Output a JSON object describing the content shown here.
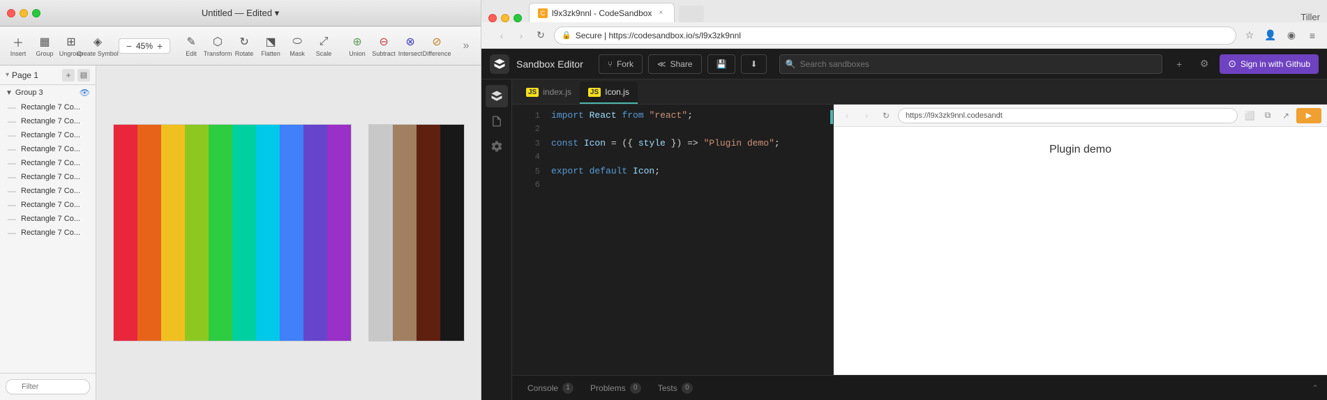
{
  "sketch": {
    "title": "Untitled — Edited ▾",
    "toolbar": {
      "insert_label": "Insert",
      "group_label": "Group",
      "ungroup_label": "Ungroup",
      "create_symbol_label": "Create Symbol",
      "zoom_label": "45%",
      "edit_label": "Edit",
      "transform_label": "Transform",
      "rotate_label": "Rotate",
      "flatten_label": "Flatten",
      "mask_label": "Mask",
      "scale_label": "Scale",
      "union_label": "Union",
      "subtract_label": "Subtract",
      "intersect_label": "Intersect",
      "difference_label": "Difference"
    },
    "sidebar": {
      "page_label": "Page 1",
      "group_name": "Group 3",
      "layers": [
        "Rectangle 7 Co...",
        "Rectangle 7 Co...",
        "Rectangle 7 Co...",
        "Rectangle 7 Co...",
        "Rectangle 7 Co...",
        "Rectangle 7 Co...",
        "Rectangle 7 Co...",
        "Rectangle 7 Co...",
        "Rectangle 7 Co...",
        "Rectangle 7 Co..."
      ],
      "filter_placeholder": "Filter"
    }
  },
  "browser": {
    "tab_title": "l9x3zk9nnl - CodeSandbox",
    "tab_close": "×",
    "url": "https://codesandbox.io/s/l9x3zk9nnl",
    "url_display": "Secure  |  https://codesandbox.io/s/l9x3zk9nnl",
    "tiller_label": "Tiller"
  },
  "codesandbox": {
    "logo_alt": "CodeSandbox",
    "title": "Sandbox Editor",
    "fork_label": "Fork",
    "fork_icon": "⑂",
    "share_label": "Share",
    "search_placeholder": "Search sandboxes",
    "add_icon": "+",
    "settings_icon": "⚙",
    "signin_label": "Sign in with Github",
    "sidebar_icons": [
      "📦",
      "📄",
      "🔧"
    ],
    "file_tabs": [
      {
        "label": "index.js",
        "active": false
      },
      {
        "label": "Icon.js",
        "active": true
      }
    ],
    "code_lines": [
      {
        "num": "1",
        "tokens": [
          {
            "type": "kw",
            "text": "import "
          },
          {
            "type": "var",
            "text": "React"
          },
          {
            "type": "punc",
            "text": " "
          },
          {
            "type": "kw",
            "text": "from"
          },
          {
            "type": "punc",
            "text": " "
          },
          {
            "type": "str",
            "text": "\"react\""
          },
          {
            "type": "punc",
            "text": ";"
          }
        ]
      },
      {
        "num": "2",
        "tokens": []
      },
      {
        "num": "3",
        "tokens": [
          {
            "type": "kw",
            "text": "const "
          },
          {
            "type": "var",
            "text": "Icon"
          },
          {
            "type": "punc",
            "text": " = ("
          },
          {
            "type": "punc",
            "text": "{ "
          },
          {
            "type": "var",
            "text": "style"
          },
          {
            "type": "punc",
            "text": " }) => "
          },
          {
            "type": "str",
            "text": "\"Plugin demo\""
          },
          {
            "type": "punc",
            "text": ";"
          }
        ]
      },
      {
        "num": "4",
        "tokens": []
      },
      {
        "num": "5",
        "tokens": [
          {
            "type": "kw",
            "text": "export "
          },
          {
            "type": "kw",
            "text": "default "
          },
          {
            "type": "var",
            "text": "Icon"
          },
          {
            "type": "punc",
            "text": ";"
          }
        ]
      },
      {
        "num": "6",
        "tokens": []
      }
    ],
    "preview": {
      "url": "https://l9x3zk9nnl.codesandt",
      "content": "Plugin demo"
    },
    "bottom_tabs": [
      {
        "label": "Console",
        "badge": "1"
      },
      {
        "label": "Problems",
        "badge": "0"
      },
      {
        "label": "Tests",
        "badge": "0"
      }
    ]
  },
  "colors": {
    "rainbow_strips": [
      "#e8263c",
      "#e8631a",
      "#f0c020",
      "#8cc820",
      "#2ecc40",
      "#00d0a0",
      "#00c8e8",
      "#4080f8",
      "#6644cc",
      "#9930c8"
    ],
    "neutral_strips": [
      "#c8c8c8",
      "#a08060",
      "#602010",
      "#181818"
    ]
  }
}
